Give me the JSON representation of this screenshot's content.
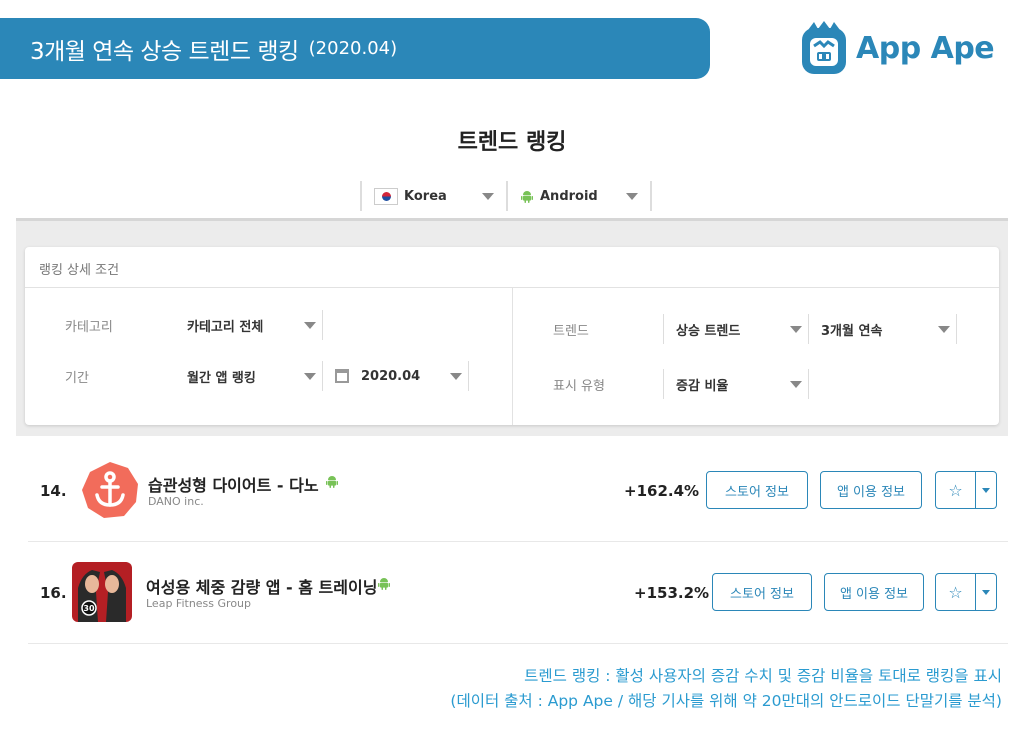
{
  "banner": {
    "title": "3개월 연속 상승 트렌드 랭킹",
    "date": "(2020.04)"
  },
  "logo": {
    "text": "App Ape"
  },
  "page_heading": "트렌드 랭킹",
  "selectors": {
    "country": "Korea",
    "os": "Android"
  },
  "filter_panel": {
    "title": "랭킹 상세 조건",
    "category_label": "카테고리",
    "category_value": "카테고리 전체",
    "period_label": "기간",
    "period_value": "월간 앱 랭킹",
    "date_value": "2020.04",
    "trend_label": "트렌드",
    "trend_value": "상승 트렌드",
    "trend_duration": "3개월 연속",
    "display_label": "표시 유형",
    "display_value": "증감 비율"
  },
  "rankings": [
    {
      "rank": "14.",
      "name": "습관성형 다이어트 - 다노",
      "developer": "DANO inc.",
      "growth": "+162.4%",
      "store_button": "스토어 정보",
      "usage_button": "앱 이용 정보"
    },
    {
      "rank": "16.",
      "name": "여성용 체중 감량 앱 - 홈 트레이닝",
      "developer": "Leap Fitness Group",
      "growth": "+153.2%",
      "store_button": "스토어 정보",
      "usage_button": "앱 이용 정보"
    }
  ],
  "footnote": {
    "line1": "트렌드 랭킹 : 활성 사용자의 증감 수치 및 증감 비율을 토대로 랭킹을 표시",
    "line2": "(데이터 출처 : App Ape / 해당 기사를 위해 약 20만대의 안드로이드 단말기를 분석)"
  },
  "colors": {
    "brand": "#2b87b8",
    "android": "#78c257",
    "dano_icon": "#f26c5b",
    "footnote": "#2b9bd0"
  },
  "icons": [
    "ape-logo-icon",
    "korea-flag-icon",
    "android-icon",
    "calendar-icon",
    "anchor-icon",
    "star-icon",
    "chevron-down-icon"
  ]
}
